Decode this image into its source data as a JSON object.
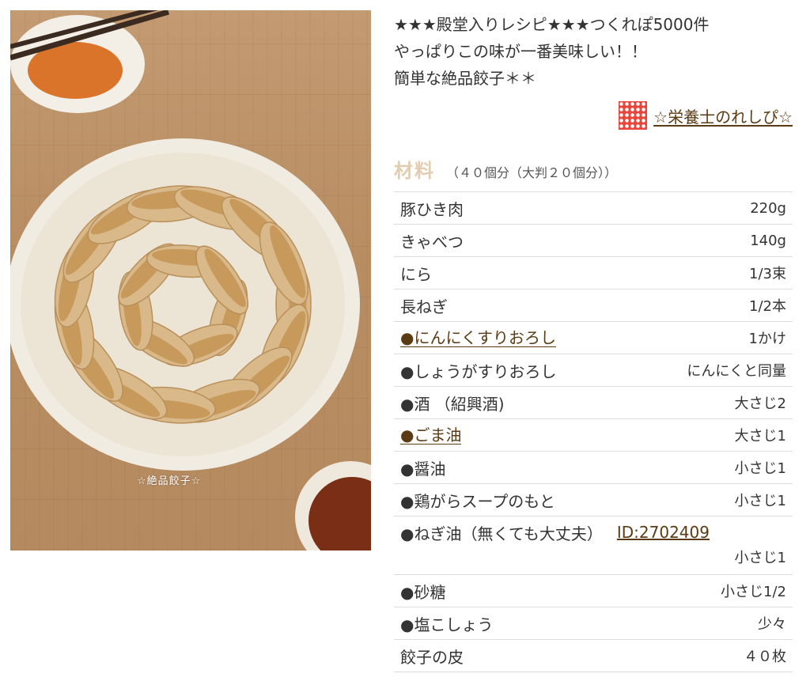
{
  "recipe": {
    "photo_caption": "☆絶品餃子☆",
    "description_lines": [
      "★★★殿堂入りレシピ★★★つくれぽ5000件",
      "やっぱりこの味が一番美味しい！！",
      "簡単な絶品餃子＊＊"
    ],
    "author": {
      "name": "☆栄養士のれしぴ☆",
      "icon": "author-avatar-icon"
    },
    "ingredients": {
      "title": "材料",
      "serving": "（４０個分（大判２０個分））",
      "items": [
        {
          "name": "豚ひき肉",
          "qty": "220g"
        },
        {
          "name": "きゃべつ",
          "qty": "140g"
        },
        {
          "name": "にら",
          "qty": "1/3束"
        },
        {
          "name": "長ねぎ",
          "qty": "1/2本"
        },
        {
          "name": "●にんにくすりおろし",
          "qty": "1かけ"
        },
        {
          "name": "●しょうがすりおろし",
          "qty": "にんにくと同量"
        },
        {
          "name": "●酒 （紹興酒)",
          "qty": "大さじ2"
        },
        {
          "name": "●ごま油",
          "qty": "大さじ1"
        },
        {
          "name": "●醤油",
          "qty": "小さじ1"
        },
        {
          "name": "●鶏がらスープのもと",
          "qty": "小さじ1"
        },
        {
          "name": "●ねぎ油（無くても大丈夫）",
          "qty": "小さじ1",
          "ref": "ID:2702409"
        },
        {
          "name": "●砂糖",
          "qty": "小さじ1/2"
        },
        {
          "name": "●塩こしょう",
          "qty": "少々"
        },
        {
          "name": "餃子の皮",
          "qty": "４０枚"
        }
      ]
    }
  },
  "colors": {
    "accent_brown": "#5b3b14",
    "title_beige": "#e3cdb1",
    "avatar_red": "#e8453c"
  }
}
